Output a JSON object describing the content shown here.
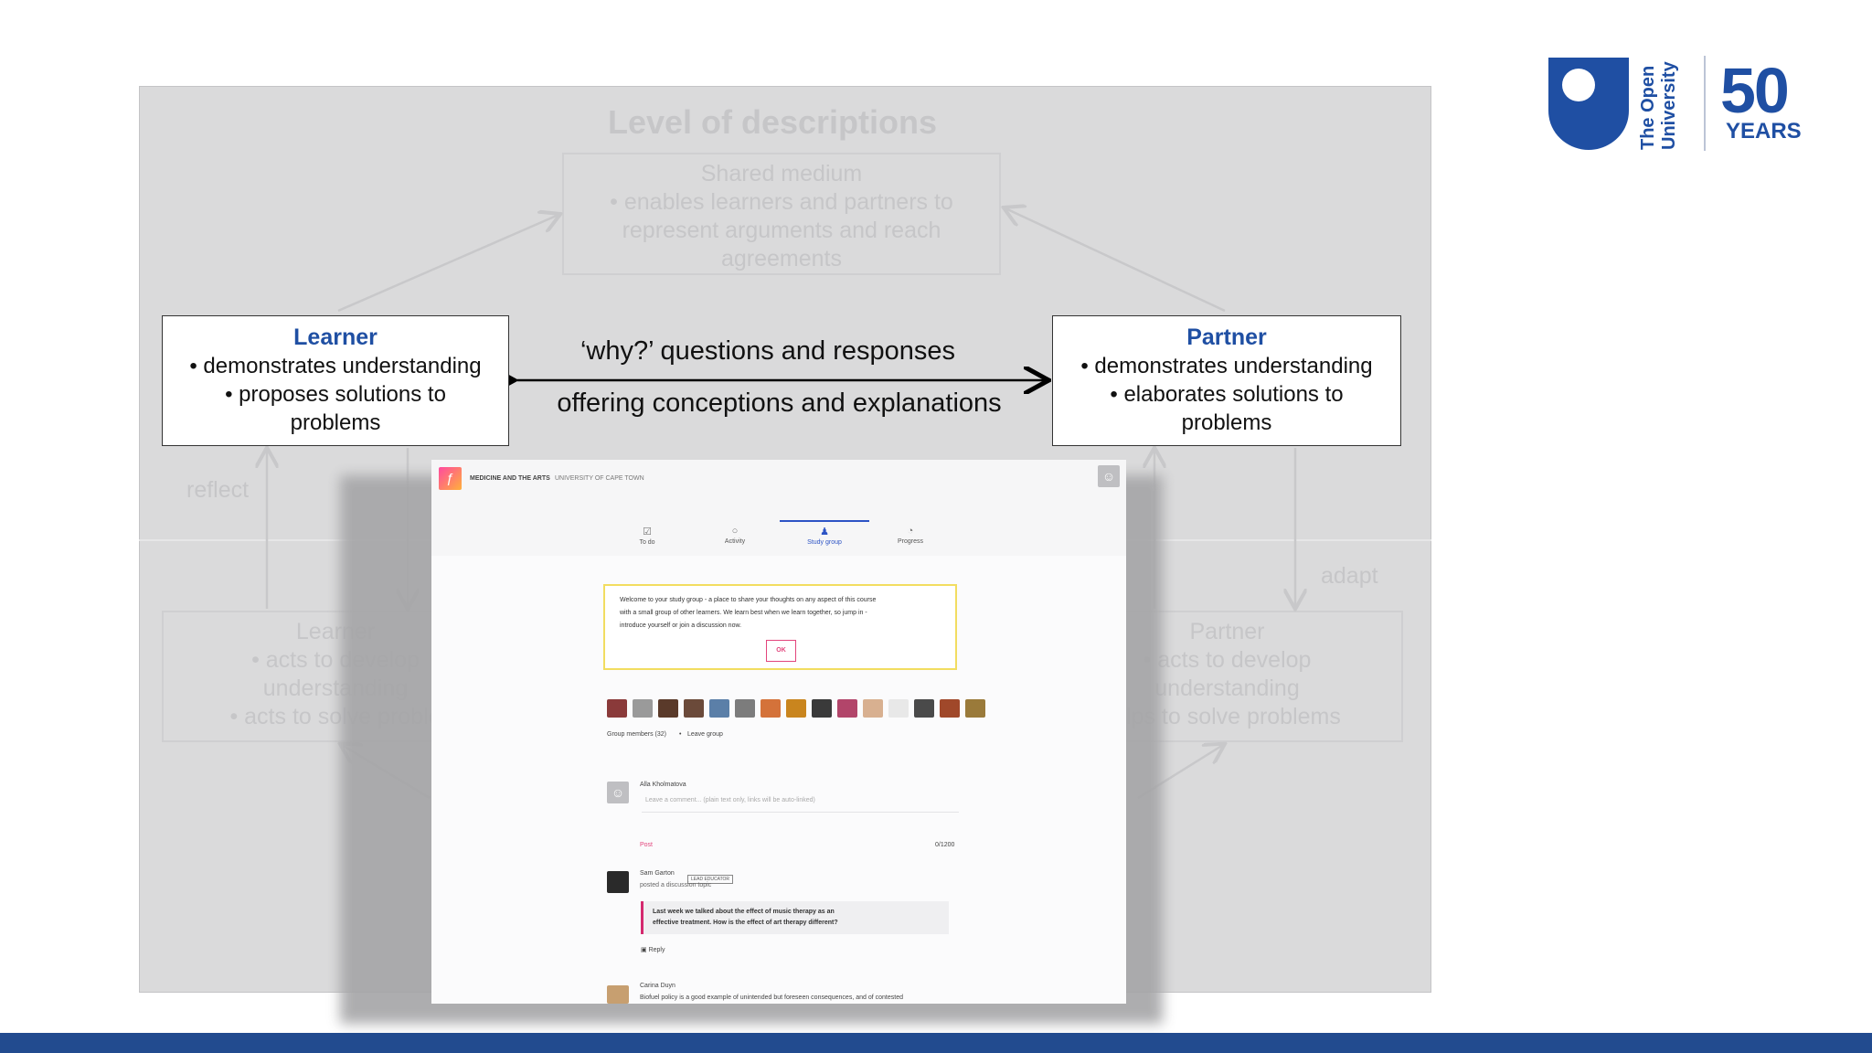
{
  "diagram": {
    "title": "Level of descriptions",
    "shared_medium": {
      "title": "Shared medium",
      "lines": [
        "• enables learners and partners to",
        "represent arguments and reach",
        "agreements"
      ]
    },
    "learner_top": {
      "title": "Learner",
      "lines": [
        "• demonstrates understanding",
        "•  proposes solutions to",
        "problems"
      ]
    },
    "partner_top": {
      "title": "Partner",
      "lines": [
        "• demonstrates understanding",
        "• elaborates solutions to",
        "problems"
      ]
    },
    "arrow_text_top": "‘why?’ questions and responses",
    "arrow_text_bottom": "offering conceptions and explanations",
    "reflect_label": "reflect",
    "adapt_label": "adapt",
    "learner_bottom": {
      "title": "Learner",
      "lines": [
        "• acts to develop",
        "understanding",
        "• acts to solve proble"
      ]
    },
    "partner_bottom": {
      "title": "Partner",
      "lines": [
        "• acts to develop",
        "understanding",
        "elps to solve problems"
      ]
    }
  },
  "screenshot": {
    "course_title": "MEDICINE AND THE ARTS",
    "institution": "UNIVERSITY OF CAPE TOWN",
    "tabs": [
      {
        "label": "To do",
        "icon": "checklist-icon"
      },
      {
        "label": "Activity",
        "icon": "activity-icon"
      },
      {
        "label": "Study group",
        "icon": "group-icon",
        "active": true
      },
      {
        "label": "Progress",
        "icon": "progress-icon"
      }
    ],
    "welcome_lines": [
      "Welcome to your study group - a place to share your thoughts on any aspect of this course",
      "with a small group of other learners. We learn best when we learn together, so jump in -",
      "introduce yourself or join a discussion now."
    ],
    "ok_label": "OK",
    "group_members": "Group members (32)",
    "separator": "•",
    "leave_group": "Leave group",
    "commenter_name": "Alla Kholmatova",
    "comment_placeholder": "Leave a comment... (plain text only, links will be auto-linked)",
    "post_label": "Post",
    "char_count": "0/1200",
    "post_author": "Sam Garton",
    "post_badge": "LEAD EDUCATOR",
    "post_subtitle": "posted a discussion topic",
    "quote_lines": [
      "Last week we talked about the effect of music therapy as an",
      "effective treatment. How is the effect of art therapy different?"
    ],
    "reply_label": "Reply",
    "reply_author": "Carina Duyn",
    "reply_text": "Biofuel policy is a good example of unintended but foreseen consequences, and of contested"
  },
  "logo": {
    "line1": "The Open",
    "line2": "University",
    "number": "50",
    "years": "YEARS"
  },
  "colors": {
    "brand_blue": "#1f4fa3",
    "footer_bar": "#224b8f",
    "accent_pink": "#e2457c",
    "study_group_blue": "#2d54c5"
  }
}
